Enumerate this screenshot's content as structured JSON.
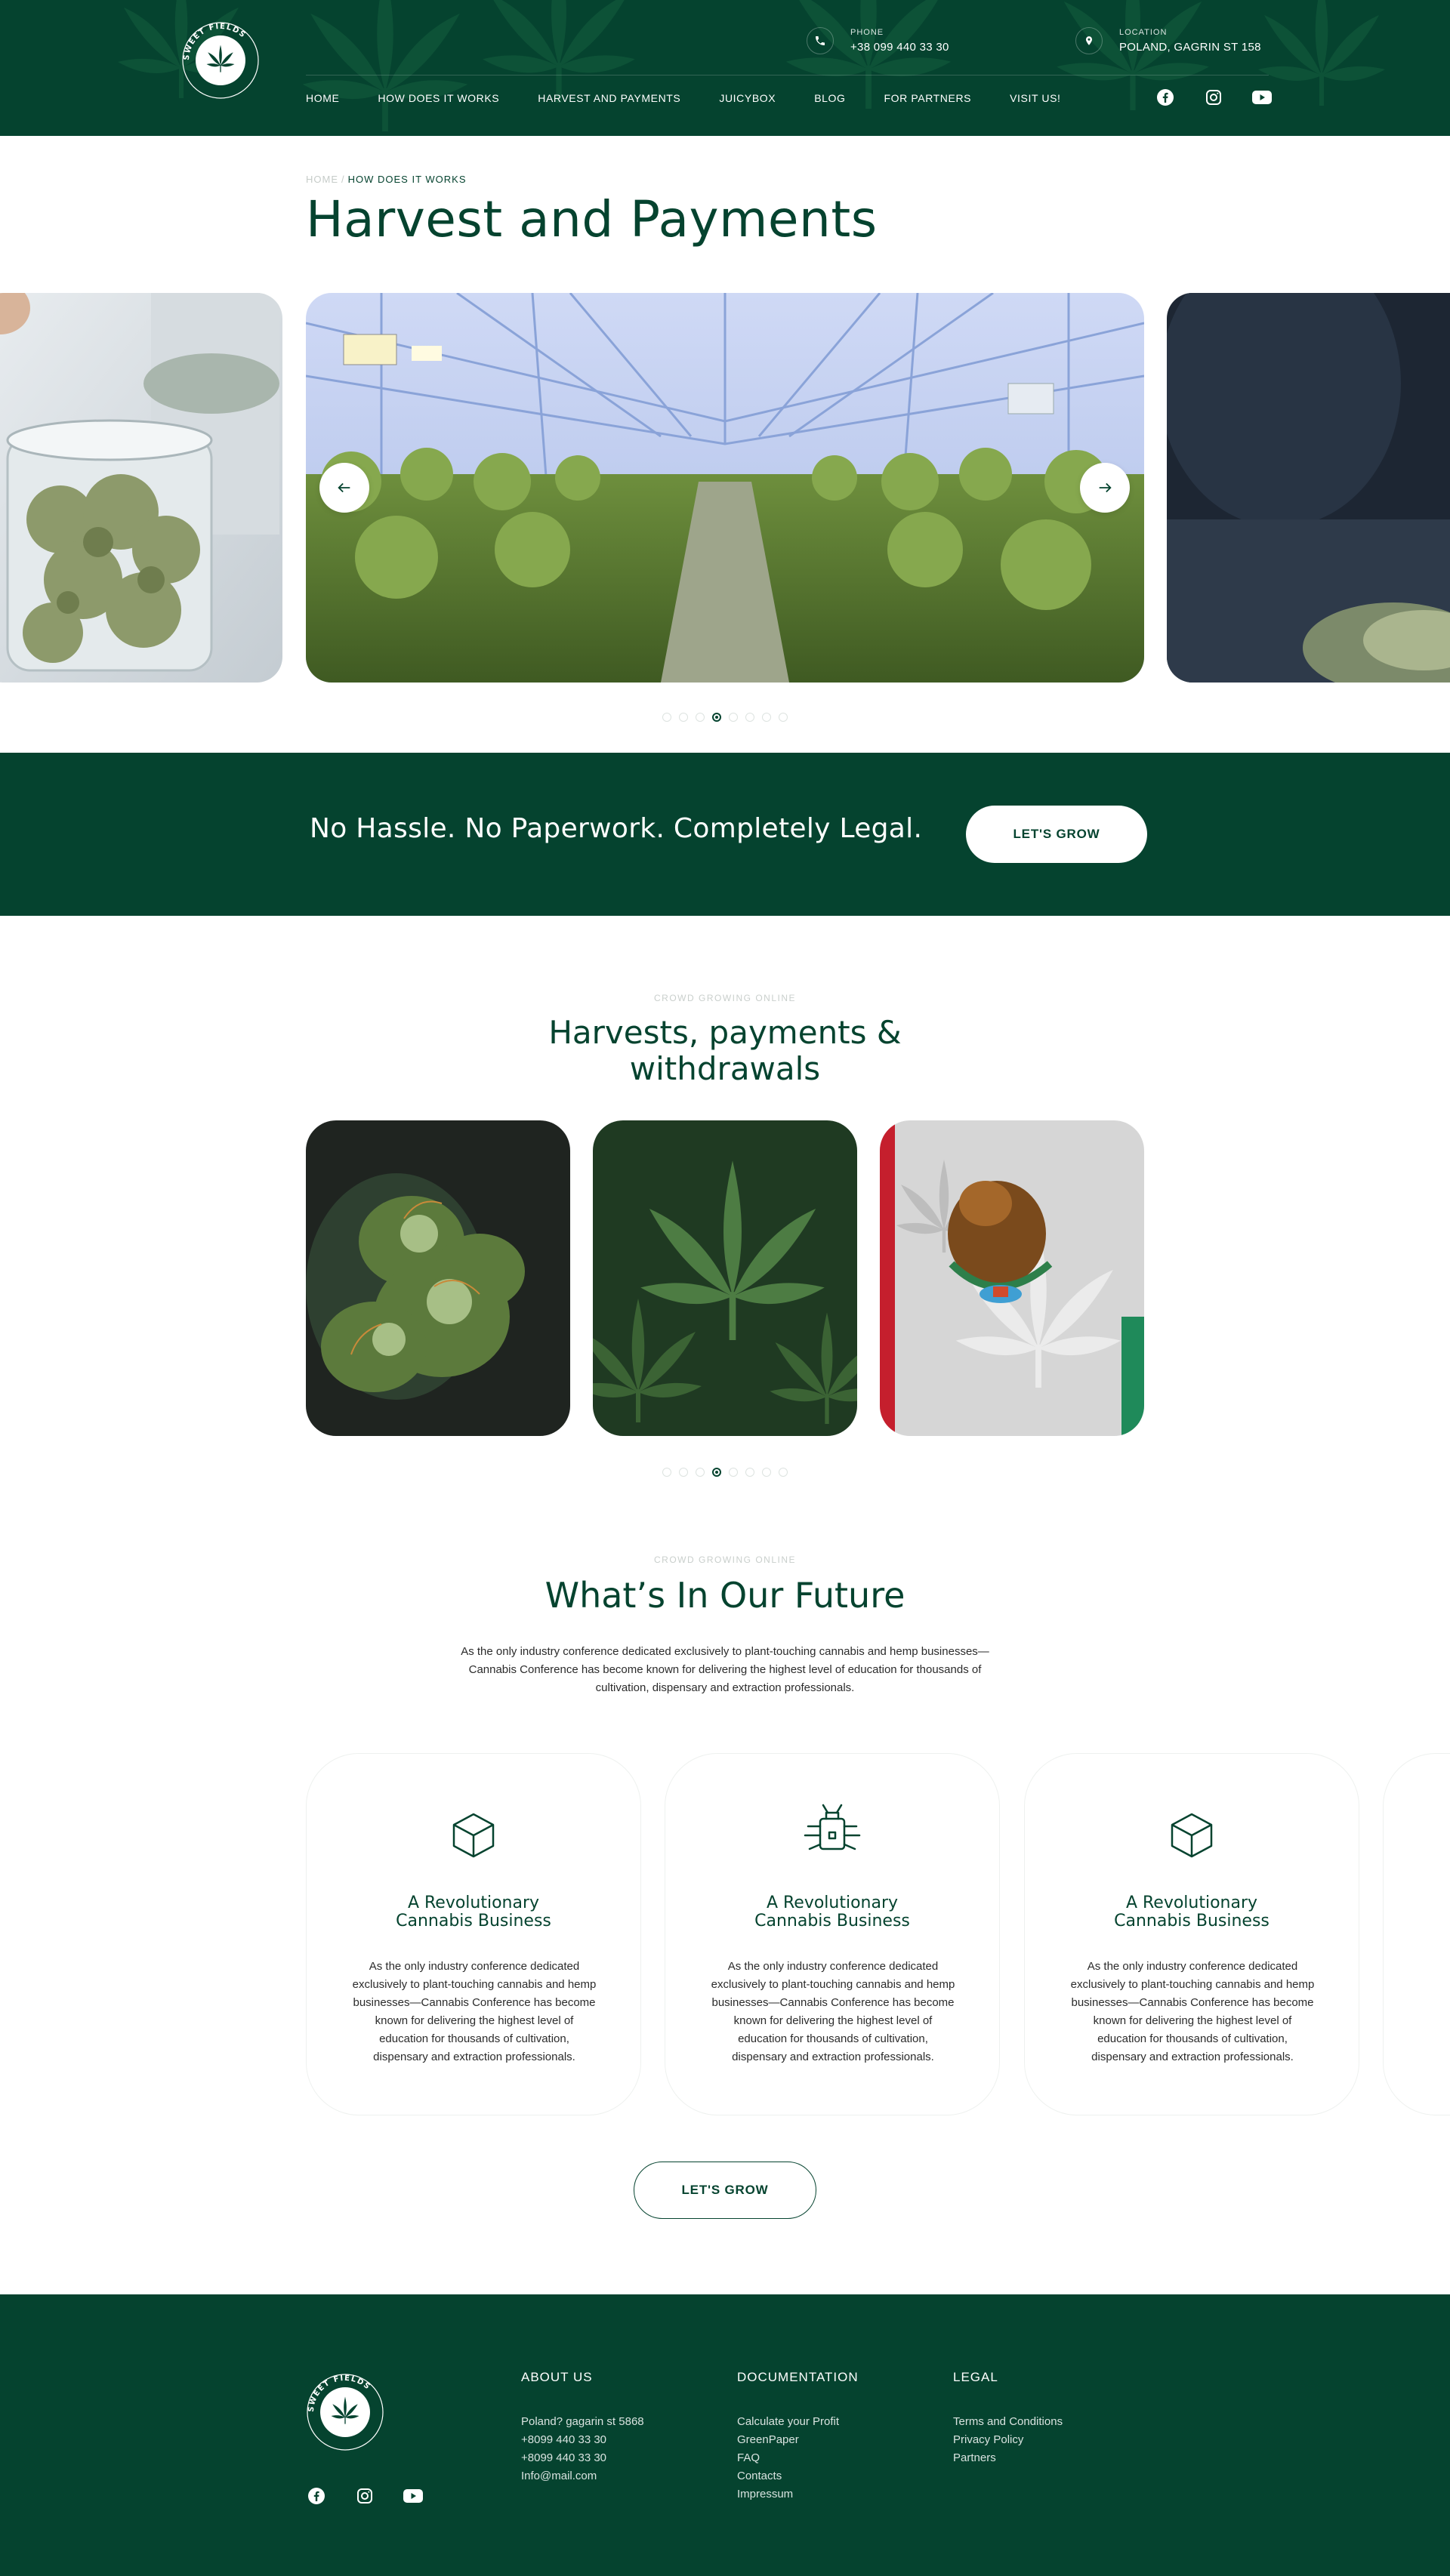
{
  "header": {
    "logo_text": "SWEET FIELDS",
    "phone": {
      "label": "PHONE",
      "value": "+38 099 440 33 30"
    },
    "location": {
      "label": "LOCATION",
      "value": "POLAND, GAGRIN ST 158"
    },
    "nav": [
      "HOME",
      "HOW DOES IT WORKS",
      "HARVEST AND PAYMENTS",
      "JUICYBOX",
      "BLOG",
      "FOR PARTNERS",
      "VISIT US!"
    ],
    "socials": [
      "facebook-icon",
      "instagram-icon",
      "youtube-icon"
    ]
  },
  "breadcrumb": {
    "home": "HOME",
    "separator": "/",
    "current": "HOW DOES IT WORKS"
  },
  "page_title": "Harvest and Payments",
  "slider": {
    "dots": 8,
    "active_dot": 4
  },
  "banner": {
    "text": "No Hassle. No Paperwork. Completely Legal.",
    "button": "LET'S GROW"
  },
  "harvests": {
    "eyebrow": "CROWD GROWING ONLINE",
    "title_line1": "Harvests, payments &",
    "title_line2": "withdrawals",
    "dots": 8,
    "active_dot": 4
  },
  "future": {
    "eyebrow": "CROWD GROWING ONLINE",
    "title": "What’s In Our Future",
    "intro": "As the only industry conference dedicated exclusively to plant-touching cannabis and hemp businesses—Cannabis Conference has become known for delivering the highest level of education for thousands of cultivation, dispensary and extraction professionals.",
    "cards": [
      {
        "icon": "cube-icon",
        "title_line1": "A Revolutionary",
        "title_line2": "Cannabis Business",
        "text": "As the only industry conference dedicated exclusively to plant-touching cannabis and hemp businesses—Cannabis Conference has become known for delivering the highest level of education for thousands of cultivation, dispensary and extraction professionals."
      },
      {
        "icon": "bug-icon",
        "title_line1": "A Revolutionary",
        "title_line2": "Cannabis Business",
        "text": "As the only industry conference dedicated exclusively to plant-touching cannabis and hemp businesses—Cannabis Conference has become known for delivering the highest level of education for thousands of cultivation, dispensary and extraction professionals."
      },
      {
        "icon": "cube-icon",
        "title_line1": "A Revolutionary",
        "title_line2": "Cannabis Business",
        "text": "As the only industry conference dedicated exclusively to plant-touching cannabis and hemp businesses—Cannabis Conference has become known for delivering the highest level of education for thousands of cultivation, dispensary and extraction professionals."
      }
    ],
    "button": "LET'S GROW"
  },
  "footer": {
    "about": {
      "title": "ABOUT US",
      "items": [
        "Poland? gagarin st 5868",
        "+8099 440 33 30",
        "+8099 440 33 30",
        "Info@mail.com"
      ]
    },
    "docs": {
      "title": "DOCUMENTATION",
      "items": [
        "Calculate your Profit",
        "GreenPaper",
        "FAQ",
        "Contacts",
        "Impressum"
      ]
    },
    "legal": {
      "title": "LEGAL",
      "items": [
        "Terms and Conditions",
        "Privacy Policy",
        "Partners"
      ]
    }
  },
  "colors": {
    "brand_green": "#05432f",
    "white": "#ffffff"
  }
}
